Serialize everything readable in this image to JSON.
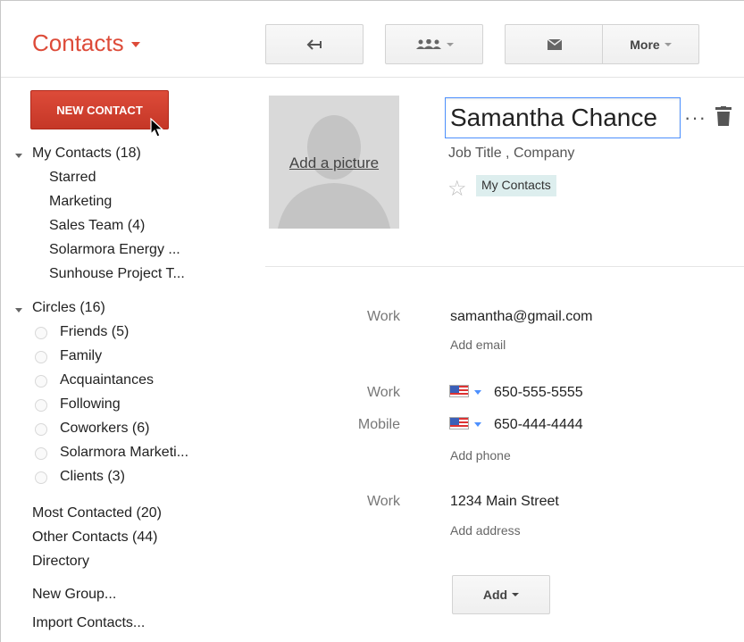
{
  "header": {
    "app_title": "Contacts",
    "toolbar": {
      "back_icon": "back-arrow-icon",
      "people_icon": "people-icon",
      "mail_icon": "mail-icon",
      "more_label": "More"
    }
  },
  "sidebar": {
    "new_contact_label": "NEW CONTACT",
    "my_contacts": {
      "label": "My Contacts (18)",
      "items": [
        "Starred",
        "Marketing",
        "Sales Team (4)",
        "Solarmora Energy ...",
        "Sunhouse Project T..."
      ]
    },
    "circles": {
      "label": "Circles (16)",
      "items": [
        "Friends (5)",
        "Family",
        "Acquaintances",
        "Following",
        "Coworkers (6)",
        "Solarmora Marketi...",
        "Clients (3)"
      ]
    },
    "other": [
      "Most Contacted (20)",
      "Other Contacts (44)",
      "Directory"
    ],
    "actions": [
      "New Group...",
      "Import Contacts..."
    ]
  },
  "contact": {
    "add_picture_label": "Add a picture",
    "name": "Samantha Chance",
    "job_title": "Job Title",
    "company": "Company",
    "group_chip": "My Contacts",
    "email": {
      "label": "Work",
      "value": "samantha@gmail.com",
      "add_label": "Add email"
    },
    "phones": [
      {
        "label": "Work",
        "value": "650-555-5555"
      },
      {
        "label": "Mobile",
        "value": "650-444-4444"
      }
    ],
    "add_phone_label": "Add phone",
    "address": {
      "label": "Work",
      "value": "1234 Main Street",
      "add_label": "Add address"
    },
    "add_button_label": "Add"
  },
  "colors": {
    "brand_red": "#dd4b39",
    "focus_blue": "#4d90fe",
    "chip_bg": "#ddeeee"
  }
}
